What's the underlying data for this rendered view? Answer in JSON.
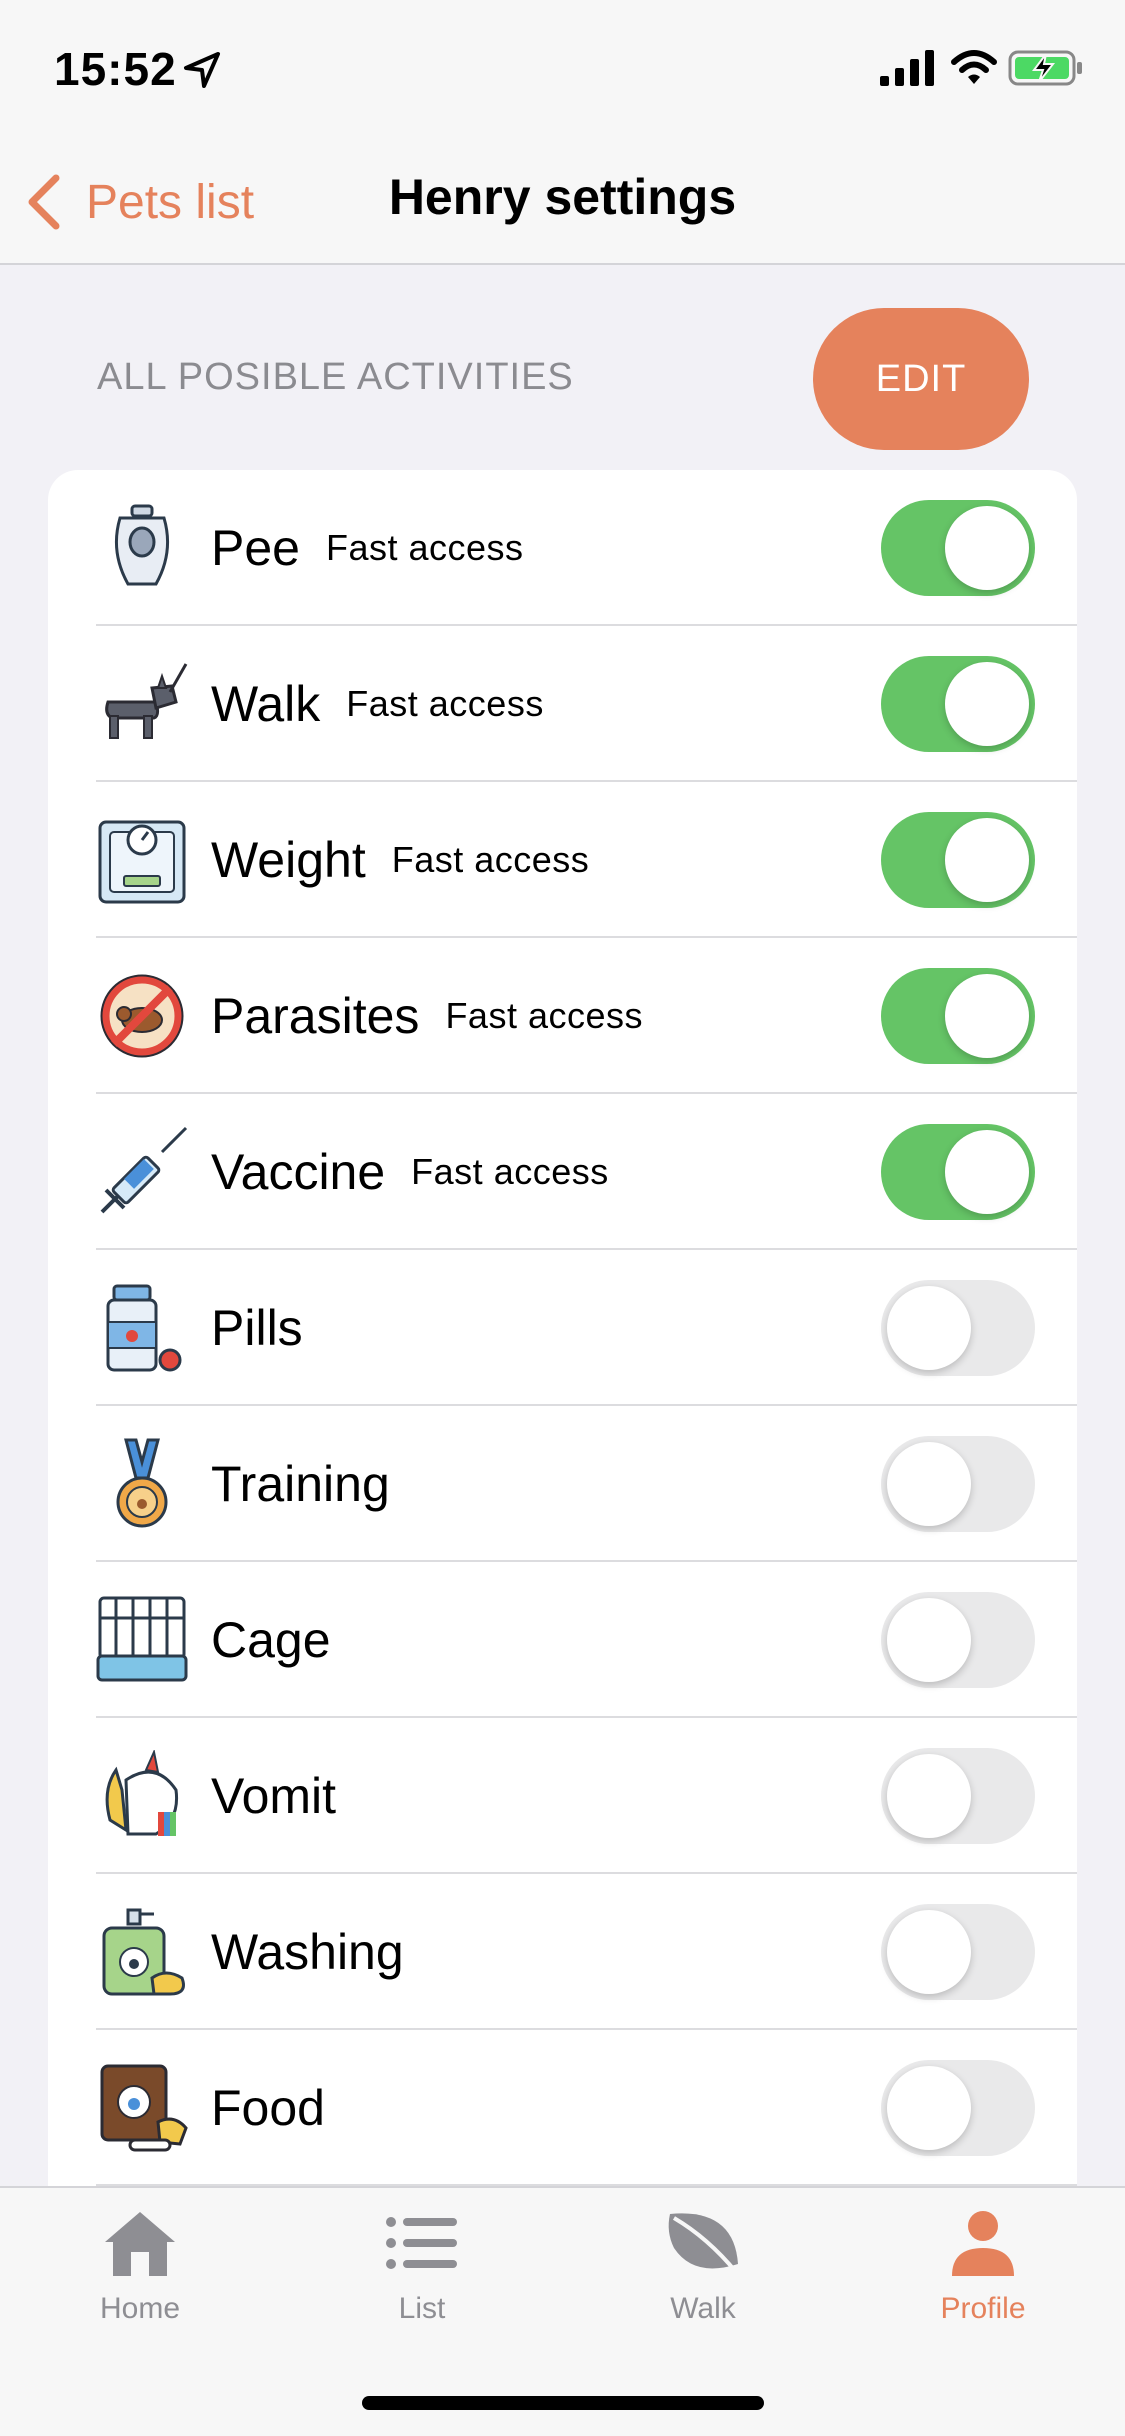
{
  "status_bar": {
    "time": "15:52"
  },
  "nav": {
    "back_label": "Pets list",
    "title": "Henry settings"
  },
  "section": {
    "header": "ALL POSIBLE ACTIVITIES",
    "edit_label": "EDIT"
  },
  "activities": [
    {
      "label": "Pee",
      "sub": "Fast access",
      "enabled": true,
      "icon": "urinal-icon"
    },
    {
      "label": "Walk",
      "sub": "Fast access",
      "enabled": true,
      "icon": "dog-walk-icon"
    },
    {
      "label": "Weight",
      "sub": "Fast access",
      "enabled": true,
      "icon": "scale-icon"
    },
    {
      "label": "Parasites",
      "sub": "Fast access",
      "enabled": true,
      "icon": "no-flea-icon"
    },
    {
      "label": "Vaccine",
      "sub": "Fast access",
      "enabled": true,
      "icon": "syringe-icon"
    },
    {
      "label": "Pills",
      "sub": "",
      "enabled": false,
      "icon": "pill-bottle-icon"
    },
    {
      "label": "Training",
      "sub": "",
      "enabled": false,
      "icon": "medal-icon"
    },
    {
      "label": "Cage",
      "sub": "",
      "enabled": false,
      "icon": "cage-icon"
    },
    {
      "label": "Vomit",
      "sub": "",
      "enabled": false,
      "icon": "unicorn-vomit-icon"
    },
    {
      "label": "Washing",
      "sub": "",
      "enabled": false,
      "icon": "shampoo-icon"
    },
    {
      "label": "Food",
      "sub": "",
      "enabled": false,
      "icon": "food-bag-icon"
    }
  ],
  "tabs": [
    {
      "label": "Home",
      "icon": "home-icon",
      "active": false
    },
    {
      "label": "List",
      "icon": "list-icon",
      "active": false
    },
    {
      "label": "Walk",
      "icon": "leaf-icon",
      "active": false
    },
    {
      "label": "Profile",
      "icon": "person-icon",
      "active": true
    }
  ],
  "colors": {
    "accent": "#e5825c",
    "toggle_on": "#65c466",
    "toggle_off": "#e9e9ea",
    "background": "#f2f1f6"
  }
}
